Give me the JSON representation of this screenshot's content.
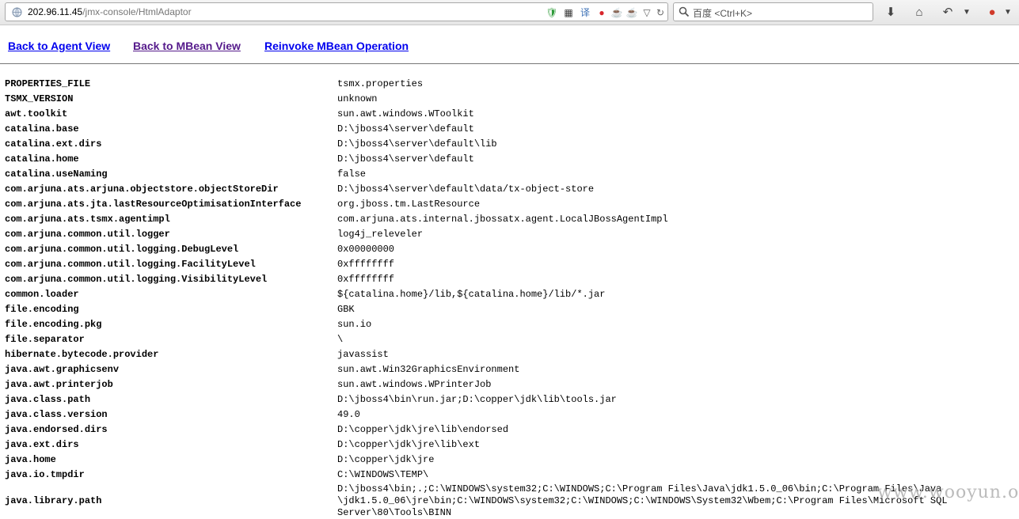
{
  "browser": {
    "url_host": "202.96.11.45",
    "url_path": "/jmx-console/HtmlAdaptor",
    "search_placeholder": "百度 <Ctrl+K>",
    "icons": [
      "globe-icon",
      "shield-icon",
      "qr-icon",
      "translate-icon",
      "weibo-icon",
      "java-icon",
      "java-icon",
      "dropdown-icon",
      "reload-icon",
      "search-icon",
      "download-icon",
      "home-icon",
      "back-icon",
      "menu-icon",
      "addon-icon"
    ]
  },
  "links": {
    "agent_view": "Back to Agent View",
    "mbean_view": "Back to MBean View",
    "reinvoke": "Reinvoke MBean Operation"
  },
  "colors": {
    "link": "#0000ee",
    "visited_link": "#551a8b"
  },
  "properties": [
    {
      "key": "PROPERTIES_FILE",
      "value": "tsmx.properties"
    },
    {
      "key": "TSMX_VERSION",
      "value": "unknown"
    },
    {
      "key": "awt.toolkit",
      "value": "sun.awt.windows.WToolkit"
    },
    {
      "key": "catalina.base",
      "value": "D:\\jboss4\\server\\default"
    },
    {
      "key": "catalina.ext.dirs",
      "value": "D:\\jboss4\\server\\default\\lib"
    },
    {
      "key": "catalina.home",
      "value": "D:\\jboss4\\server\\default"
    },
    {
      "key": "catalina.useNaming",
      "value": "false"
    },
    {
      "key": "com.arjuna.ats.arjuna.objectstore.objectStoreDir",
      "value": "D:\\jboss4\\server\\default\\data/tx-object-store"
    },
    {
      "key": "com.arjuna.ats.jta.lastResourceOptimisationInterface",
      "value": "org.jboss.tm.LastResource"
    },
    {
      "key": "com.arjuna.ats.tsmx.agentimpl",
      "value": "com.arjuna.ats.internal.jbossatx.agent.LocalJBossAgentImpl"
    },
    {
      "key": "com.arjuna.common.util.logger",
      "value": "log4j_releveler"
    },
    {
      "key": "com.arjuna.common.util.logging.DebugLevel",
      "value": "0x00000000"
    },
    {
      "key": "com.arjuna.common.util.logging.FacilityLevel",
      "value": "0xffffffff"
    },
    {
      "key": "com.arjuna.common.util.logging.VisibilityLevel",
      "value": "0xffffffff"
    },
    {
      "key": "common.loader",
      "value": "${catalina.home}/lib,${catalina.home}/lib/*.jar"
    },
    {
      "key": "file.encoding",
      "value": "GBK"
    },
    {
      "key": "file.encoding.pkg",
      "value": "sun.io"
    },
    {
      "key": "file.separator",
      "value": "\\"
    },
    {
      "key": "hibernate.bytecode.provider",
      "value": "javassist"
    },
    {
      "key": "java.awt.graphicsenv",
      "value": "sun.awt.Win32GraphicsEnvironment"
    },
    {
      "key": "java.awt.printerjob",
      "value": "sun.awt.windows.WPrinterJob"
    },
    {
      "key": "java.class.path",
      "value": "D:\\jboss4\\bin\\run.jar;D:\\copper\\jdk\\lib\\tools.jar"
    },
    {
      "key": "java.class.version",
      "value": "49.0"
    },
    {
      "key": "java.endorsed.dirs",
      "value": "D:\\copper\\jdk\\jre\\lib\\endorsed"
    },
    {
      "key": "java.ext.dirs",
      "value": "D:\\copper\\jdk\\jre\\lib\\ext"
    },
    {
      "key": "java.home",
      "value": "D:\\copper\\jdk\\jre"
    },
    {
      "key": "java.io.tmpdir",
      "value": "C:\\WINDOWS\\TEMP\\"
    },
    {
      "key": "java.library.path",
      "value": "D:\\jboss4\\bin;.;C:\\WINDOWS\\system32;C:\\WINDOWS;C:\\Program Files\\Java\\jdk1.5.0_06\\bin;C:\\Program Files\\Java\n\\jdk1.5.0_06\\jre\\bin;C:\\WINDOWS\\system32;C:\\WINDOWS;C:\\WINDOWS\\System32\\Wbem;C:\\Program Files\\Microsoft SQL\nServer\\80\\Tools\\BINN"
    }
  ],
  "watermark": "www.wooyun.org"
}
